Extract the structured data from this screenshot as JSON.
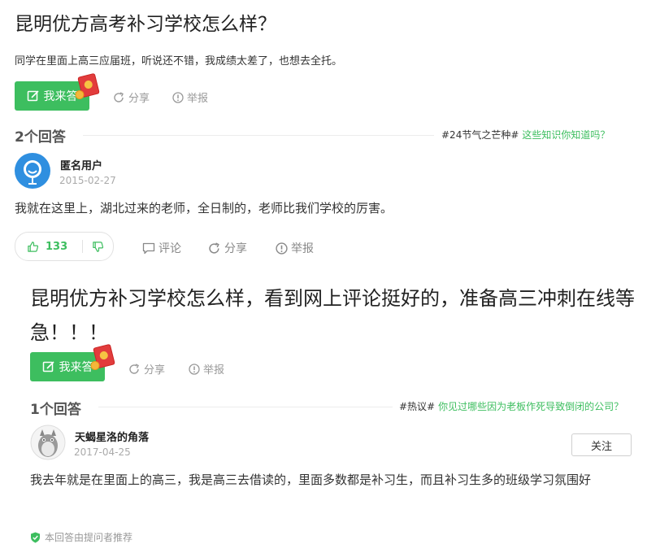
{
  "q1": {
    "title": "昆明优方高考补习学校怎么样？",
    "desc": "同学在里面上高三应届班，听说还不错，我成绩太差了，也想去全托。",
    "answer_btn": "我来答",
    "share": "分享",
    "report": "举报",
    "answer_count": "2个回答",
    "tag": "#24节气之芒种#",
    "tag_link": "这些知识你知道吗？",
    "answer": {
      "user": "匿名用户",
      "date": "2015-02-27",
      "text": "我就在这里上，湖北过来的老师，全日制的，老师比我们学校的厉害。",
      "likes": "133",
      "comment": "评论",
      "share": "分享",
      "report": "举报"
    }
  },
  "q2": {
    "title": "昆明优方补习学校怎么样，看到网上评论挺好的，准备高三冲刺在线等急！！！",
    "answer_btn": "我来答",
    "share": "分享",
    "report": "举报",
    "answer_count": "1个回答",
    "tag": "#热议#",
    "tag_link": "你见过哪些因为老板作死导致倒闭的公司？",
    "answer": {
      "user": "天蝎星洛的角落",
      "date": "2017-04-25",
      "follow": "关注",
      "text": "我去年就是在里面上的高三，我是高三去借读的，里面多数都是补习生，而且补习生多的班级学习氛围好",
      "recommend": "本回答由提问者推荐"
    }
  },
  "colors": {
    "accent": "#3dbe5f",
    "red_packet": "#e23c3c"
  },
  "icons": [
    "pen-icon",
    "red-packet-icon",
    "share-icon",
    "report-icon",
    "thumb-up-icon",
    "thumb-down-icon",
    "comment-icon",
    "shield-check-icon",
    "avatar"
  ]
}
